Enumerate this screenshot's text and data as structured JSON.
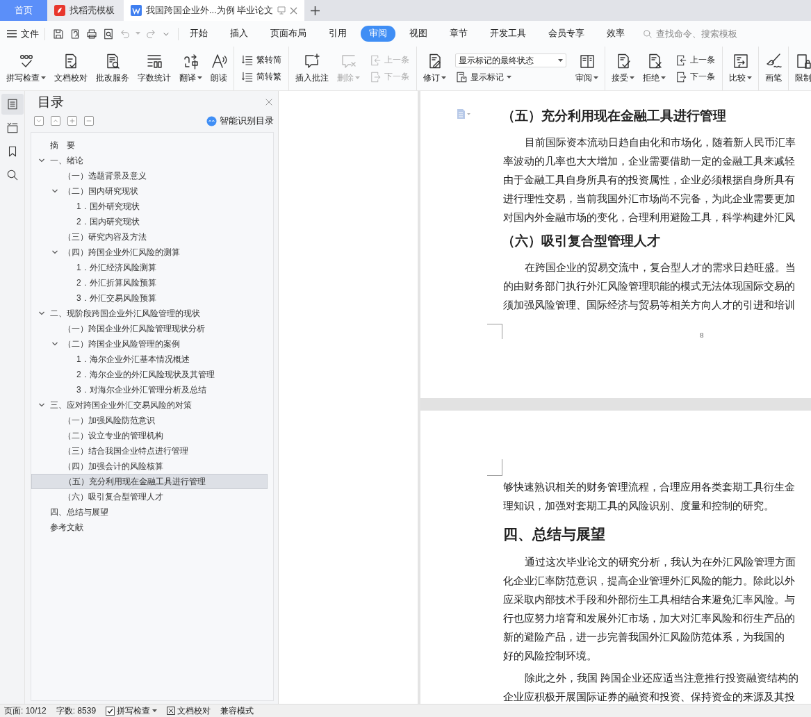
{
  "tabs": [
    {
      "label": "首页",
      "kind": "home",
      "selected": false
    },
    {
      "label": "找稻壳模板",
      "kind": "docer",
      "selected": false
    },
    {
      "label": "我国跨国企业外...为例 毕业论文",
      "kind": "document",
      "selected": true
    }
  ],
  "menu": {
    "file": "文件",
    "tabs": [
      {
        "label": "开始",
        "selected": false
      },
      {
        "label": "插入",
        "selected": false
      },
      {
        "label": "页面布局",
        "selected": false
      },
      {
        "label": "引用",
        "selected": false
      },
      {
        "label": "审阅",
        "selected": true
      },
      {
        "label": "视图",
        "selected": false
      },
      {
        "label": "章节",
        "selected": false
      },
      {
        "label": "开发工具",
        "selected": false
      },
      {
        "label": "会员专享",
        "selected": false
      },
      {
        "label": "效率",
        "selected": false
      }
    ],
    "search": {
      "placeholder": "查找命令、搜索模板"
    }
  },
  "ribbon": [
    {
      "items": [
        {
          "kind": "large",
          "label": "拼写检查",
          "dropdown": true,
          "disabled": false
        },
        {
          "kind": "large",
          "label": "文档校对",
          "dropdown": false,
          "disabled": false
        },
        {
          "kind": "large",
          "label": "批改服务",
          "dropdown": false,
          "disabled": false
        },
        {
          "kind": "large",
          "label": "字数统计",
          "dropdown": false,
          "disabled": false
        },
        {
          "kind": "large",
          "label": "翻译",
          "dropdown": true,
          "disabled": false
        },
        {
          "kind": "large",
          "label": "朗读",
          "dropdown": false,
          "disabled": false
        }
      ]
    },
    {
      "items": [
        {
          "kind": "stack",
          "entries": [
            {
              "label": "繁转简",
              "disabled": false
            },
            {
              "label": "简转繁",
              "disabled": false
            }
          ]
        }
      ]
    },
    {
      "items": [
        {
          "kind": "large",
          "label": "插入批注",
          "dropdown": false,
          "disabled": false
        },
        {
          "kind": "large",
          "label": "删除",
          "dropdown": true,
          "disabled": true
        },
        {
          "kind": "stack",
          "entries": [
            {
              "label": "上一条",
              "disabled": true
            },
            {
              "label": "下一条",
              "disabled": true
            }
          ]
        }
      ]
    },
    {
      "items": [
        {
          "kind": "large",
          "label": "修订",
          "dropdown": true,
          "disabled": false
        },
        {
          "kind": "combo",
          "value": "显示标记的最终状态",
          "button": "显示标记"
        },
        {
          "kind": "large",
          "label": "审阅",
          "dropdown": true,
          "disabled": false
        }
      ]
    },
    {
      "items": [
        {
          "kind": "large",
          "label": "接受",
          "dropdown": true,
          "disabled": false
        },
        {
          "kind": "large",
          "label": "拒绝",
          "dropdown": true,
          "disabled": false
        },
        {
          "kind": "stack",
          "entries": [
            {
              "label": "上一条",
              "disabled": false
            },
            {
              "label": "下一条",
              "disabled": false
            }
          ]
        }
      ]
    },
    {
      "items": [
        {
          "kind": "large",
          "label": "比较",
          "dropdown": true,
          "disabled": false
        }
      ]
    },
    {
      "items": [
        {
          "kind": "large",
          "label": "画笔",
          "dropdown": false,
          "disabled": false
        }
      ]
    },
    {
      "items": [
        {
          "kind": "large",
          "label": "限制",
          "dropdown": false,
          "disabled": false
        }
      ]
    }
  ],
  "sidebar": {
    "rail": [
      {
        "selected": true
      },
      {
        "selected": false
      },
      {
        "selected": false
      },
      {
        "selected": false
      }
    ],
    "title": "目录",
    "smart_toc": "智能识别目录",
    "tree": [
      {
        "label": "摘　要",
        "selected": false
      },
      {
        "label": "一、绪论",
        "selected": false,
        "expanded": true,
        "children": [
          {
            "label": "（一）选题背景及意义",
            "selected": false
          },
          {
            "label": "（二）国内研究现状",
            "selected": false,
            "expanded": true,
            "children": [
              {
                "label": "1．国外研究现状",
                "selected": false
              },
              {
                "label": "2．国内研究现状",
                "selected": false
              }
            ]
          },
          {
            "label": "（三）研究内容及方法",
            "selected": false
          },
          {
            "label": "（四）跨国企业外汇风险的测算",
            "selected": false,
            "expanded": true,
            "children": [
              {
                "label": "1．外汇经济风险测算",
                "selected": false
              },
              {
                "label": "2．外汇折算风险预算",
                "selected": false
              },
              {
                "label": "3．外汇交易风险预算",
                "selected": false
              }
            ]
          }
        ]
      },
      {
        "label": "二、现阶段跨国企业外汇风险管理的现状",
        "selected": false,
        "expanded": true,
        "children": [
          {
            "label": "（一）跨国企业外汇风险管理现状分析",
            "selected": false
          },
          {
            "label": "（二）跨国企业风险管理的案例",
            "selected": false,
            "expanded": true,
            "children": [
              {
                "label": "1．海尔企业外汇基本情况概述",
                "selected": false
              },
              {
                "label": "2．海尔企业的外汇风险现状及其管理",
                "selected": false
              },
              {
                "label": "3．对海尔企业外汇管理分析及总结",
                "selected": false
              }
            ]
          }
        ]
      },
      {
        "label": "三、应对跨国企业外汇交易风险的对策",
        "selected": false,
        "expanded": true,
        "children": [
          {
            "label": "（一）加强风险防范意识",
            "selected": false
          },
          {
            "label": "（二）设立专业的管理机构",
            "selected": false
          },
          {
            "label": "（三）结合我国企业特点进行管理",
            "selected": false
          },
          {
            "label": "（四）加强会计的风险核算",
            "selected": false
          },
          {
            "label": "（五）充分利用现在金融工具进行管理",
            "selected": true
          },
          {
            "label": "（六）吸引复合型管理人才",
            "selected": false
          }
        ]
      },
      {
        "label": "四、总结与展望",
        "selected": false
      },
      {
        "label": "参考文献",
        "selected": false
      }
    ]
  },
  "pages": [
    {
      "blocks": [
        {
          "kind": "heading2",
          "text": "（五）充分利用现在金融工具进行管理"
        },
        {
          "kind": "paragraph",
          "lines": [
            "目前国际资本流动日趋自由化和市场化，随着新人民币汇率",
            "率波动的几率也大大增加，企业需要借助一定的金融工具来减轻",
            "由于金融工具自身所具有的投资属性，企业必须根据自身所具有",
            "进行理性交易，当前我国外汇市场尚不完备，为此企业需要更加",
            "对国内外金融市场的变化，合理利用避险工具，科学构建外汇风"
          ]
        },
        {
          "kind": "heading2",
          "text": "（六）吸引复合型管理人才"
        },
        {
          "kind": "paragraph",
          "lines": [
            "在跨国企业的贸易交流中，复合型人才的需求日趋旺盛。当",
            "的由财务部门执行外汇风险管理职能的模式无法体现国际交易的",
            "须加强风险管理、国际经济与贸易等相关方向人才的引进和培训"
          ]
        }
      ],
      "page_number": "8"
    },
    {
      "blocks": [
        {
          "kind": "continuation",
          "lines": [
            "够快速熟识相关的财务管理流程，合理应用各类套期工具衍生金",
            "理知识，加强对套期工具的风险识别、度量和控制的研究。"
          ]
        },
        {
          "kind": "heading1",
          "text": "四、总结与展望"
        },
        {
          "kind": "paragraph",
          "lines": [
            "通过这次毕业论文的研究分析，我认为在外汇风险管理方面",
            "化企业汇率防范意识，提高企业管理外汇风险的能力。除此以外",
            "应采取内部技术手段和外部衍生工具相结合来避免汇率风险。与",
            "行也应努力培育和发展外汇市场，加大对汇率风险和衍生产品的",
            "新的避险产品，进一步完善我国外汇风险防范体系，为我国的",
            "好的风险控制环境。"
          ]
        },
        {
          "kind": "paragraph",
          "lines": [
            "除此之外，我国 跨国企业还应适当注意推行投资融资结构的",
            "企业应积极开展国际证券的融资和投资、保持资金的来源及其投"
          ]
        }
      ]
    }
  ],
  "status_bar": {
    "page": "页面: 10/12",
    "words": "字数: 8539",
    "spell_check": {
      "label": "拼写检查",
      "checked": true
    },
    "proofread": "文档校对",
    "mode": "兼容模式"
  }
}
